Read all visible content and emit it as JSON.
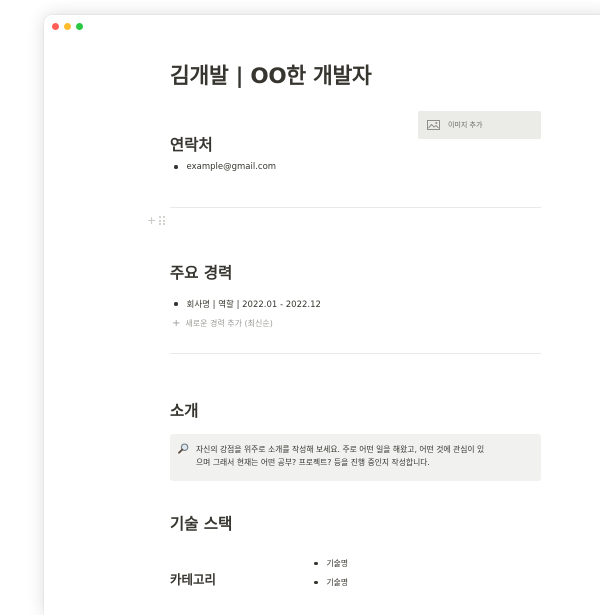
{
  "page": {
    "title": "김개발  |  OO한 개발자",
    "image_add_label": "이미지 추가"
  },
  "contact": {
    "heading": "연락처",
    "items": [
      "example@gmail.com"
    ]
  },
  "career": {
    "heading": "주요 경력",
    "items": [
      "회사명  |  역할  |  2022.01 - 2022.12"
    ],
    "add_label": "새로운 경력 추가 (최신순)"
  },
  "intro": {
    "heading": "소개",
    "callout_line1": "자신의 강점을 위주로 소개를 작성해 보세요. 주로 어떤 일을 해왔고, 어떤 것에 관심이 있",
    "callout_line2": "으며 그래서 현재는 어떤 공부? 프로젝트? 등을 진행 중인지 작성합니다.",
    "callout_icon": "magnifier-icon"
  },
  "skills": {
    "heading": "기술 스택",
    "category": "카테고리",
    "items": [
      "기술명",
      "기술명"
    ]
  },
  "colors": {
    "text": "#37352f",
    "muted": "#9b9a97",
    "callout_bg": "#f1f1ef",
    "image_button_bg": "#ebebe8"
  }
}
